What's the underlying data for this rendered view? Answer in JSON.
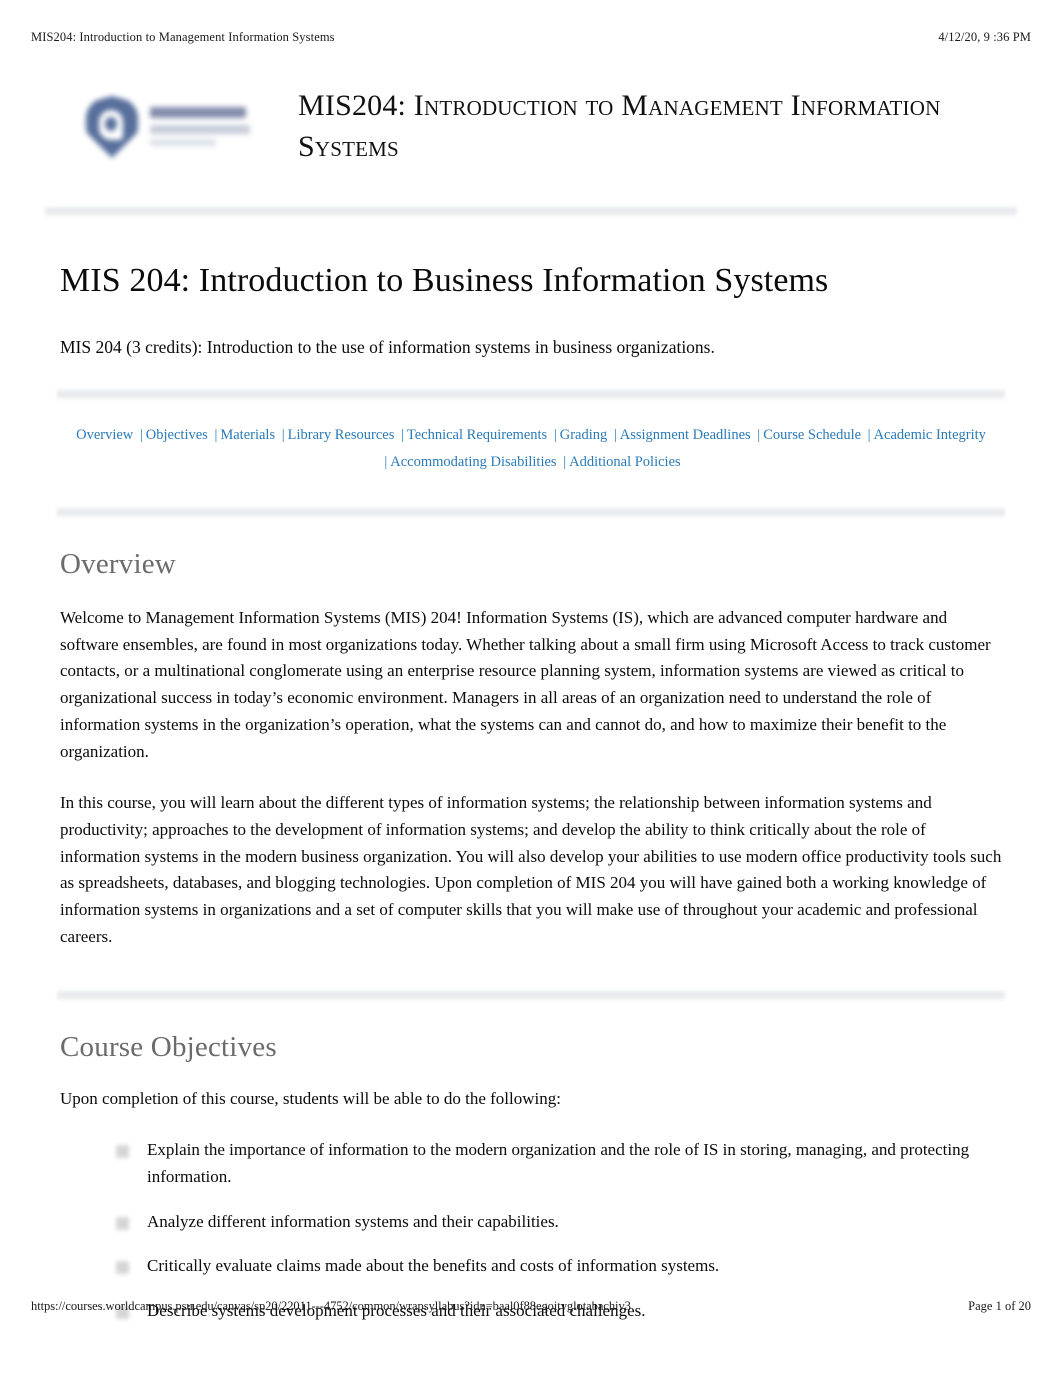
{
  "print_header": {
    "left": "MIS204: Introduction to Management Information Systems",
    "right": "4/12/20, 9  :36 PM"
  },
  "print_footer": {
    "url": "https://courses.worldcampus.psu.edu/canvas/sp20/22011---4752/common/wrapsyllabus?idn=baal0f88egoitvglotabachiv3",
    "page": "Page 1 of 20"
  },
  "masthead": {
    "logo_name": "penn-state-world-campus-logo",
    "title": "MIS204: Introduction to Management Information Systems"
  },
  "doc": {
    "title": "MIS 204: Introduction to Business Information Systems",
    "lede": "MIS 204 (3 credits): Introduction to the use of information systems in business organizations."
  },
  "nav": {
    "row1": [
      "Overview",
      "Objectives",
      "Materials",
      "Library Resources",
      "Technical Requirements",
      "Grading",
      "Assignment Deadlines",
      "Course Schedule",
      "Academic Integrity"
    ],
    "row2": [
      "Accommodating Disabilities",
      "Additional Policies"
    ],
    "separator": "|"
  },
  "overview": {
    "heading": "Overview",
    "paragraph1": "Welcome to Management Information Systems (MIS) 204! Information Systems (IS), which are advanced computer hardware and software ensembles, are found in most organizations today. Whether talking about a small firm using Microsoft Access to track customer contacts, or a multinational conglomerate using an enterprise resource planning system, information systems are viewed as critical to organizational success in today’s economic environment. Managers in all areas of an organization need to understand the role of information systems in the organization’s operation, what the systems can and cannot do, and how to maximize their benefit to the organization.",
    "paragraph2": "In this course, you will learn about the different types of information systems; the relationship between information systems and productivity; approaches to the development of information systems; and develop the ability to think critically about the role of information systems in the modern business organization. You will also develop your abilities to use modern office productivity tools such as spreadsheets, databases, and blogging technologies. Upon completion of MIS 204 you will have gained both a working knowledge of information systems in organizations and a set of computer skills that you will make use of throughout your academic and professional careers."
  },
  "objectives": {
    "heading": "Course Objectives",
    "intro": "Upon completion of this course, students will be able to do the following:",
    "items": [
      "Explain the importance of information to the modern organization and the role of IS in storing, managing, and protecting information.",
      "Analyze different information systems and their capabilities.",
      "Critically evaluate claims made about the benefits and costs of information systems.",
      "Describe systems development processes and their associated challenges."
    ]
  },
  "colors": {
    "link": "#2a7ab8",
    "heading_gray": "#6b6b6b",
    "rule_gray": "#e8e9ec",
    "logo_blue": "#4a6394"
  }
}
